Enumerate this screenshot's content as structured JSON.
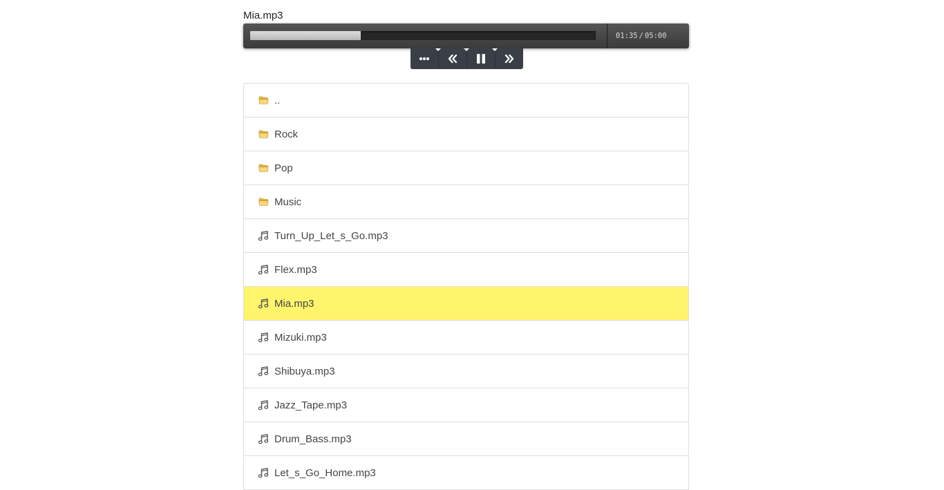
{
  "player": {
    "now_playing": "Mia.mp3",
    "progress_fraction": 0.32,
    "current_time": "01:35",
    "time_separator": "/",
    "total_time": "05:00",
    "controls": [
      {
        "name": "menu-button",
        "icon": "ellipsis-icon"
      },
      {
        "name": "previous-button",
        "icon": "double-chevron-left-icon"
      },
      {
        "name": "pause-button",
        "icon": "pause-icon"
      },
      {
        "name": "next-button",
        "icon": "double-chevron-right-icon"
      }
    ]
  },
  "colors": {
    "player_bg": "#444444",
    "control_bg": "#3a3f47",
    "active_row": "#fff56c",
    "folder_icon": "#f5c75a"
  },
  "file_list": {
    "items": [
      {
        "label": "..",
        "type": "folder",
        "icon": "folder-open-icon",
        "active": false
      },
      {
        "label": "Rock",
        "type": "folder",
        "icon": "folder-open-icon",
        "active": false
      },
      {
        "label": "Pop",
        "type": "folder",
        "icon": "folder-open-icon",
        "active": false
      },
      {
        "label": "Music",
        "type": "folder",
        "icon": "folder-open-icon",
        "active": false
      },
      {
        "label": "Turn_Up_Let_s_Go.mp3",
        "type": "audio",
        "icon": "music-note-icon",
        "active": false
      },
      {
        "label": "Flex.mp3",
        "type": "audio",
        "icon": "music-note-icon",
        "active": false
      },
      {
        "label": "Mia.mp3",
        "type": "audio",
        "icon": "music-note-icon",
        "active": true
      },
      {
        "label": "Mizuki.mp3",
        "type": "audio",
        "icon": "music-note-icon",
        "active": false
      },
      {
        "label": "Shibuya.mp3",
        "type": "audio",
        "icon": "music-note-icon",
        "active": false
      },
      {
        "label": "Jazz_Tape.mp3",
        "type": "audio",
        "icon": "music-note-icon",
        "active": false
      },
      {
        "label": "Drum_Bass.mp3",
        "type": "audio",
        "icon": "music-note-icon",
        "active": false
      },
      {
        "label": "Let_s_Go_Home.mp3",
        "type": "audio",
        "icon": "music-note-icon",
        "active": false
      }
    ]
  }
}
